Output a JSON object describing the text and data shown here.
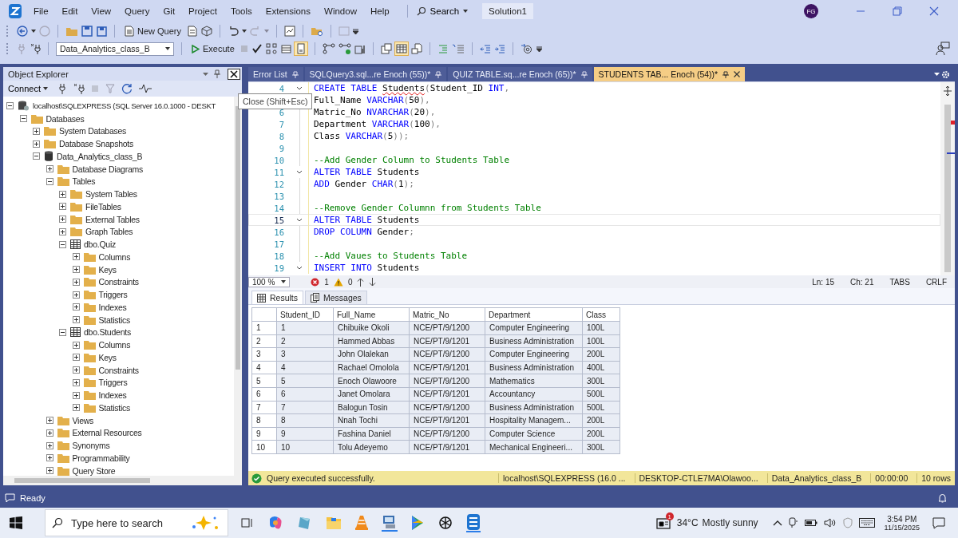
{
  "menu_bar": {
    "items": [
      "File",
      "Edit",
      "View",
      "Query",
      "Git",
      "Project",
      "Tools",
      "Extensions",
      "Window",
      "Help"
    ],
    "search": "Search",
    "solution": "Solution1",
    "account": "FG"
  },
  "toolbar": {
    "new_query": "New Query",
    "database": "Data_Analytics_class_B",
    "execute": "Execute"
  },
  "object_explorer": {
    "title": "Object Explorer",
    "connect": "Connect",
    "tooltip": "Close (Shift+Esc)",
    "tree": [
      {
        "label": "localhost\\SQLEXPRESS (SQL Server 16.0.1000 - DESKT",
        "kind": "server",
        "expanded": true,
        "children": [
          {
            "label": "Databases",
            "kind": "folder",
            "expanded": true,
            "children": [
              {
                "label": "System Databases",
                "kind": "folder",
                "expanded": false
              },
              {
                "label": "Database Snapshots",
                "kind": "folder",
                "expanded": false
              },
              {
                "label": "Data_Analytics_class_B",
                "kind": "database",
                "expanded": true,
                "children": [
                  {
                    "label": "Database Diagrams",
                    "kind": "folder",
                    "expanded": false
                  },
                  {
                    "label": "Tables",
                    "kind": "folder",
                    "expanded": true,
                    "children": [
                      {
                        "label": "System Tables",
                        "kind": "folder",
                        "expanded": false
                      },
                      {
                        "label": "FileTables",
                        "kind": "folder",
                        "expanded": false
                      },
                      {
                        "label": "External Tables",
                        "kind": "folder",
                        "expanded": false
                      },
                      {
                        "label": "Graph Tables",
                        "kind": "folder",
                        "expanded": false
                      },
                      {
                        "label": "dbo.Quiz",
                        "kind": "table",
                        "expanded": true,
                        "children": [
                          {
                            "label": "Columns",
                            "kind": "folder",
                            "expanded": false
                          },
                          {
                            "label": "Keys",
                            "kind": "folder",
                            "expanded": false
                          },
                          {
                            "label": "Constraints",
                            "kind": "folder",
                            "expanded": false
                          },
                          {
                            "label": "Triggers",
                            "kind": "folder",
                            "expanded": false
                          },
                          {
                            "label": "Indexes",
                            "kind": "folder",
                            "expanded": false
                          },
                          {
                            "label": "Statistics",
                            "kind": "folder",
                            "expanded": false
                          }
                        ]
                      },
                      {
                        "label": "dbo.Students",
                        "kind": "table",
                        "expanded": true,
                        "children": [
                          {
                            "label": "Columns",
                            "kind": "folder",
                            "expanded": false
                          },
                          {
                            "label": "Keys",
                            "kind": "folder",
                            "expanded": false
                          },
                          {
                            "label": "Constraints",
                            "kind": "folder",
                            "expanded": false
                          },
                          {
                            "label": "Triggers",
                            "kind": "folder",
                            "expanded": false
                          },
                          {
                            "label": "Indexes",
                            "kind": "folder",
                            "expanded": false
                          },
                          {
                            "label": "Statistics",
                            "kind": "folder",
                            "expanded": false
                          }
                        ]
                      }
                    ]
                  },
                  {
                    "label": "Views",
                    "kind": "folder",
                    "expanded": false
                  },
                  {
                    "label": "External Resources",
                    "kind": "folder",
                    "expanded": false
                  },
                  {
                    "label": "Synonyms",
                    "kind": "folder",
                    "expanded": false
                  },
                  {
                    "label": "Programmability",
                    "kind": "folder",
                    "expanded": false
                  },
                  {
                    "label": "Query Store",
                    "kind": "folder",
                    "expanded": false
                  }
                ]
              }
            ]
          }
        ]
      }
    ]
  },
  "editor_tabs": [
    {
      "label": "Error List",
      "selected": false
    },
    {
      "label": "SQLQuery3.sql...re Enoch (55))*",
      "selected": false
    },
    {
      "label": "QUIZ TABLE.sq...re Enoch (65))*",
      "selected": false
    },
    {
      "label": "STUDENTS TAB... Enoch (54))*",
      "selected": true
    }
  ],
  "code_lines": [
    {
      "n": "4",
      "fold": true,
      "current": false,
      "tokens": [
        {
          "kind": "keyword",
          "text": "CREATE TABLE "
        },
        {
          "kind": "error",
          "text": "Students"
        },
        {
          "kind": "punct",
          "text": "("
        },
        {
          "kind": "name",
          "text": "Student_ID "
        },
        {
          "kind": "keyword",
          "text": "INT"
        },
        {
          "kind": "punct",
          "text": ","
        }
      ]
    },
    {
      "fold": false,
      "current": false,
      "tokens": [
        {
          "kind": "name",
          "text": "Full_Name "
        },
        {
          "kind": "keyword",
          "text": "VARCHAR"
        },
        {
          "kind": "punct",
          "text": "("
        },
        {
          "kind": "name",
          "text": "50"
        },
        {
          "kind": "punct",
          "text": "),"
        }
      ]
    },
    {
      "n": "6",
      "fold": false,
      "current": false,
      "tokens": [
        {
          "kind": "name",
          "text": "Matric_No "
        },
        {
          "kind": "keyword",
          "text": "NVARCHAR"
        },
        {
          "kind": "punct",
          "text": "("
        },
        {
          "kind": "name",
          "text": "20"
        },
        {
          "kind": "punct",
          "text": "),"
        }
      ]
    },
    {
      "n": "7",
      "fold": false,
      "current": false,
      "tokens": [
        {
          "kind": "name",
          "text": "Department "
        },
        {
          "kind": "keyword",
          "text": "VARCHAR"
        },
        {
          "kind": "punct",
          "text": "("
        },
        {
          "kind": "name",
          "text": "100"
        },
        {
          "kind": "punct",
          "text": "),"
        }
      ]
    },
    {
      "n": "8",
      "fold": false,
      "current": false,
      "tokens": [
        {
          "kind": "name",
          "text": "Class "
        },
        {
          "kind": "keyword",
          "text": "VARCHAR"
        },
        {
          "kind": "punct",
          "text": "("
        },
        {
          "kind": "name",
          "text": "5"
        },
        {
          "kind": "punct",
          "text": "));"
        }
      ]
    },
    {
      "n": "9",
      "fold": false,
      "current": false
    },
    {
      "n": "10",
      "fold": false,
      "current": false,
      "tokens": [
        {
          "kind": "comment",
          "text": "--Add Gender Column to Students Table"
        }
      ]
    },
    {
      "n": "11",
      "fold": true,
      "current": false,
      "tokens": [
        {
          "kind": "keyword",
          "text": "ALTER TABLE "
        },
        {
          "kind": "name",
          "text": "Students"
        }
      ]
    },
    {
      "n": "12",
      "fold": false,
      "current": false,
      "tokens": [
        {
          "kind": "keyword",
          "text": "ADD "
        },
        {
          "kind": "name",
          "text": "Gender "
        },
        {
          "kind": "keyword",
          "text": "CHAR"
        },
        {
          "kind": "punct",
          "text": "("
        },
        {
          "kind": "name",
          "text": "1"
        },
        {
          "kind": "punct",
          "text": ");"
        }
      ]
    },
    {
      "n": "13",
      "fold": false,
      "current": false
    },
    {
      "n": "14",
      "fold": false,
      "current": false,
      "tokens": [
        {
          "kind": "comment",
          "text": "--Remove Gender Columnn from Students Table"
        }
      ]
    },
    {
      "n": "15",
      "fold": true,
      "current": true,
      "tokens": [
        {
          "kind": "keyword",
          "text": "ALTER TABLE "
        },
        {
          "kind": "name",
          "text": "Students"
        }
      ]
    },
    {
      "n": "16",
      "fold": false,
      "current": false,
      "tokens": [
        {
          "kind": "keyword",
          "text": "DROP COLUMN "
        },
        {
          "kind": "name",
          "text": "Gender"
        },
        {
          "kind": "punct",
          "text": ";"
        }
      ]
    },
    {
      "n": "17",
      "fold": false,
      "current": false
    },
    {
      "n": "18",
      "fold": false,
      "current": false,
      "tokens": [
        {
          "kind": "comment",
          "text": "--Add Vaues to Students Table"
        }
      ]
    },
    {
      "n": "19",
      "fold": true,
      "current": false,
      "tokens": [
        {
          "kind": "keyword",
          "text": "INSERT INTO "
        },
        {
          "kind": "name",
          "text": "Students"
        }
      ]
    }
  ],
  "editor_status": {
    "zoom": "100 %",
    "errors": "1",
    "warnings": "0",
    "line": "Ln: 15",
    "column": "Ch: 21",
    "indent": "TABS",
    "line_ending": "CRLF"
  },
  "result_tabs": [
    {
      "label": "Results",
      "selected": true
    },
    {
      "label": "Messages",
      "selected": false
    }
  ],
  "table": {
    "columns": [
      "Student_ID",
      "Full_Name",
      "Matric_No",
      "Department",
      "Class"
    ],
    "rows": [
      {
        "number": "1",
        "cells": [
          "1",
          "Chibuike Okoli",
          "NCE/PT/9/1200",
          "Computer Engineering",
          "100L"
        ]
      },
      {
        "number": "2",
        "cells": [
          "2",
          "Hammed Abbas",
          "NCE/PT/9/1201",
          "Business Administration",
          "100L"
        ]
      },
      {
        "number": "3",
        "cells": [
          "3",
          "John Olalekan",
          "NCE/PT/9/1200",
          "Computer Engineering",
          "200L"
        ]
      },
      {
        "number": "4",
        "cells": [
          "4",
          "Rachael Omolola",
          "NCE/PT/9/1201",
          "Business Administration",
          "400L"
        ]
      },
      {
        "number": "5",
        "cells": [
          "5",
          "Enoch Olawoore",
          "NCE/PT/9/1200",
          "Mathematics",
          "300L"
        ]
      },
      {
        "number": "6",
        "cells": [
          "6",
          "Janet Omolara",
          "NCE/PT/9/1201",
          "Accountancy",
          "500L"
        ]
      },
      {
        "number": "7",
        "cells": [
          "7",
          "Balogun Tosin",
          "NCE/PT/9/1200",
          "Business Administration",
          "500L"
        ]
      },
      {
        "number": "8",
        "cells": [
          "8",
          "Nnah Tochi",
          "NCE/PT/9/1201",
          "Hospitality Managem...",
          "200L"
        ]
      },
      {
        "number": "9",
        "cells": [
          "9",
          "Fashina Daniel",
          "NCE/PT/9/1200",
          "Computer Science",
          "200L"
        ]
      },
      {
        "number": "10",
        "cells": [
          "10",
          "Tolu Adeyemo",
          "NCE/PT/9/1201",
          "Mechanical Engineeri...",
          "300L"
        ]
      }
    ]
  },
  "query_status": {
    "message": "Query executed successfully.",
    "server": "localhost\\SQLEXPRESS (16.0 ...",
    "user": "DESKTOP-CTLE7MA\\Olawoo...",
    "database": "Data_Analytics_class_B",
    "elapsed": "00:00:00",
    "rows": "10 rows"
  },
  "status_bar": "Ready",
  "taskbar": {
    "search_placeholder": "Type here to search",
    "weather_badge": "1",
    "temperature": "34°C",
    "weather": "Mostly sunny",
    "time": "3:54 PM",
    "date": "11/15/2025"
  }
}
